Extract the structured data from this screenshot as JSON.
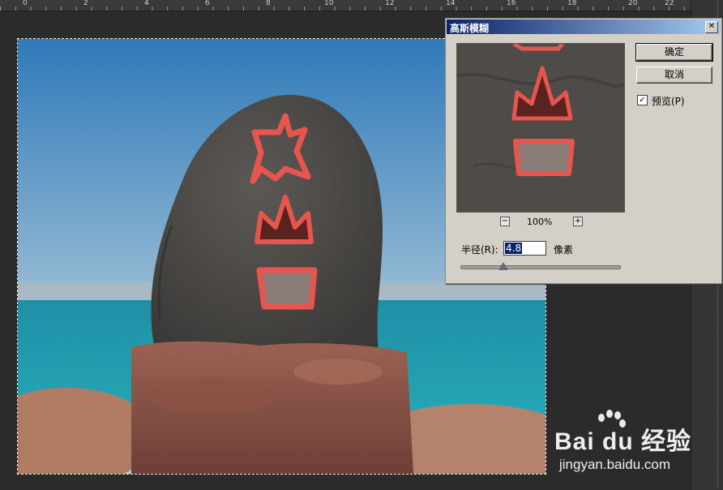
{
  "ruler": {
    "labels": [
      "0",
      "2",
      "4",
      "6",
      "8",
      "10",
      "12",
      "14",
      "16",
      "18",
      "20",
      "22"
    ]
  },
  "dialog": {
    "title": "高斯模糊",
    "close_glyph": "✕",
    "ok_label": "确定",
    "cancel_label": "取消",
    "preview_checkbox": {
      "checked": true,
      "mark": "✓",
      "label": "预览(P)"
    },
    "zoom": {
      "minus": "−",
      "plus": "+",
      "level": "100%"
    },
    "radius": {
      "label": "半径(R):",
      "value": "4.8",
      "unit": "像素",
      "slider_fraction": 0.27
    }
  },
  "canvas": {
    "stone_text": [
      "火",
      "山",
      "口"
    ],
    "colors": {
      "sky_top": "#2f7ab8",
      "sea": "#1f8fa6",
      "stone": "#4f4c49",
      "base": "#7d4a41",
      "carving": "#e8554f"
    }
  },
  "watermark": {
    "brand": "Bai du 经验",
    "url": "jingyan.baidu.com"
  }
}
